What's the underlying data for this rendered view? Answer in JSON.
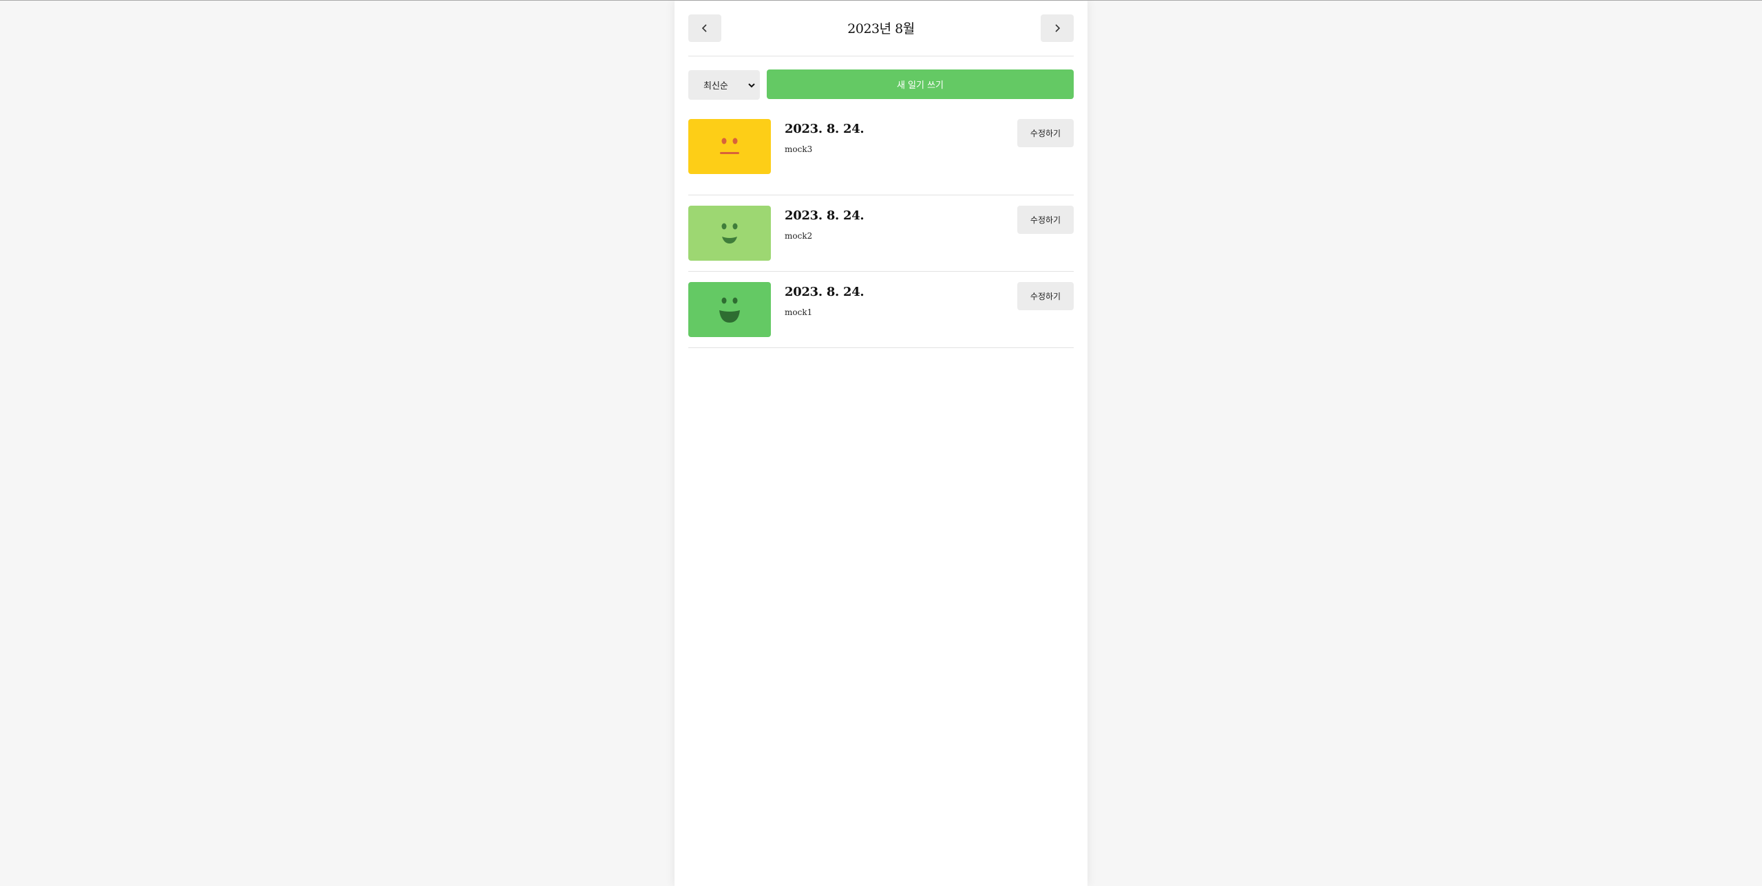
{
  "header": {
    "title": "2023년 8월",
    "prev_icon": "chevron-left-icon",
    "next_icon": "chevron-right-icon"
  },
  "toolbar": {
    "sort_selected": "최신순",
    "new_label": "새 일기 쓰기"
  },
  "colors": {
    "page_bg": "#f6f6f6",
    "button_gray": "#ececec",
    "accent_green": "#64c964"
  },
  "diaries": [
    {
      "date": "2023. 8. 24.",
      "content": "mock3",
      "edit_label": "수정하기",
      "emotion_color": "#fdce17",
      "emotion_icon": "neutral-face-icon"
    },
    {
      "date": "2023. 8. 24.",
      "content": "mock2",
      "edit_label": "수정하기",
      "emotion_color": "#9dd772",
      "emotion_icon": "smile-face-icon"
    },
    {
      "date": "2023. 8. 24.",
      "content": "mock1",
      "edit_label": "수정하기",
      "emotion_color": "#64c964",
      "emotion_icon": "grin-face-icon"
    }
  ]
}
